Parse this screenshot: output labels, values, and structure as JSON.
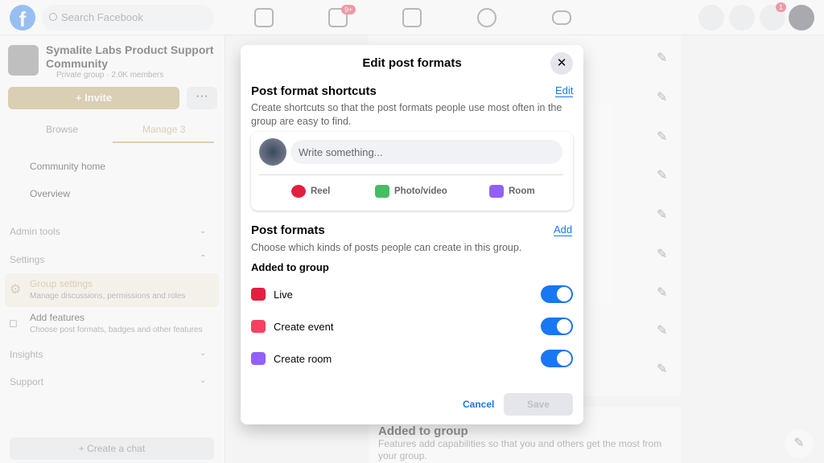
{
  "topbar": {
    "logo": "f",
    "search_placeholder": "Search Facebook",
    "watch_badge": "9+",
    "notif_badge": "1",
    "nav_icons": [
      "home-icon",
      "watch-icon",
      "marketplace-icon",
      "groups-icon",
      "gaming-icon"
    ]
  },
  "sidebar": {
    "group_name": "Symalite Labs Product Support Community",
    "group_meta": "Private group · 2.0K members",
    "invite": "+ Invite",
    "more": "···",
    "tabs": [
      "Browse",
      "Manage"
    ],
    "tab_manage_count": "3",
    "items": [
      {
        "label": "Community home"
      },
      {
        "label": "Overview"
      }
    ],
    "sections": {
      "admin_tools": "Admin tools",
      "settings": "Settings",
      "insights": "Insights",
      "support": "Support"
    },
    "group_settings": {
      "label": "Group settings",
      "sub": "Manage discussions, permissions and roles"
    },
    "add_features": {
      "label": "Add features",
      "sub": "Choose post formats, badges and other features"
    },
    "create_chat": "+ Create a chat"
  },
  "main": {
    "card_title": "Added to group",
    "card_desc": "Features add capabilities so that you and others get the most from your group."
  },
  "modal": {
    "title": "Edit post formats",
    "shortcuts_title": "Post format shortcuts",
    "shortcuts_edit": "Edit",
    "shortcuts_desc": "Create shortcuts so that the post formats people use most often in the group are easy to find.",
    "write_placeholder": "Write something...",
    "shortcuts": [
      {
        "label": "Reel",
        "color": "#e41e3f"
      },
      {
        "label": "Photo/video",
        "color": "#45bd62"
      },
      {
        "label": "Room",
        "color": "#9360f7"
      }
    ],
    "formats_title": "Post formats",
    "formats_add": "Add",
    "formats_desc": "Choose which kinds of posts people can create in this group.",
    "added_label": "Added to group",
    "formats": [
      {
        "label": "Live",
        "color": "#e41e3f",
        "enabled": true
      },
      {
        "label": "Create event",
        "color": "#f3425f",
        "enabled": true
      },
      {
        "label": "Create room",
        "color": "#9360f7",
        "enabled": true
      }
    ],
    "cancel": "Cancel",
    "save": "Save"
  }
}
